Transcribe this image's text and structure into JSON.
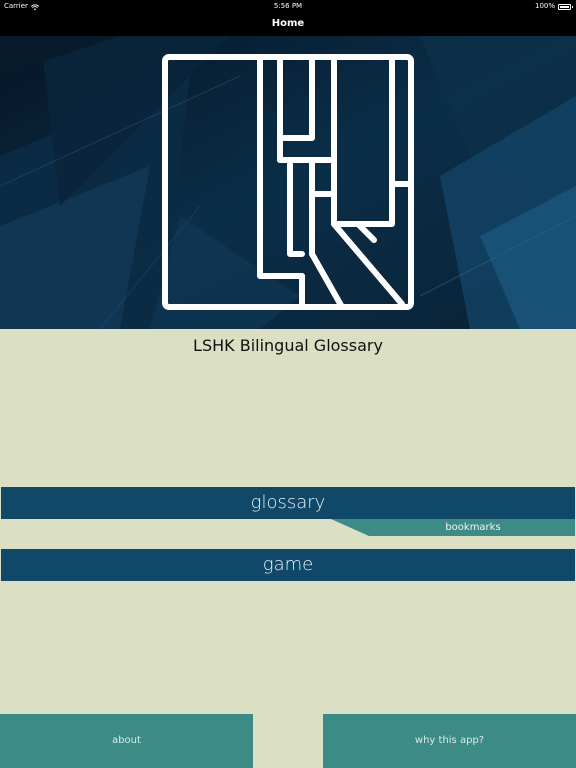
{
  "status_bar": {
    "carrier": "Carrier",
    "time": "5:56 PM",
    "battery": "100%"
  },
  "nav": {
    "title": "Home"
  },
  "hero": {
    "logo_icon": "lshk-logo-icon",
    "background_colors": [
      "#061a2c",
      "#0e3550",
      "#1b5678"
    ]
  },
  "main": {
    "title": "LSHK Bilingual Glossary",
    "glossary_label": "glossary",
    "bookmarks_label": "bookmarks",
    "game_label": "game"
  },
  "footer": {
    "about_label": "about",
    "why_label": "why this app?"
  },
  "colors": {
    "background": "#dbdfc4",
    "primary_button": "#0f4868",
    "secondary_button": "#3d8b87",
    "bar": "#000000"
  }
}
